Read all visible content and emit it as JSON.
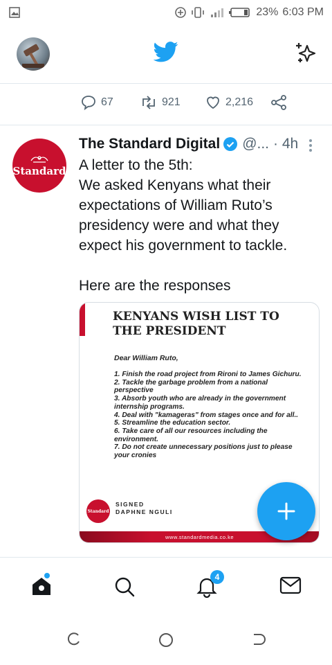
{
  "status_bar": {
    "battery_percent": "23%",
    "time": "6:03 PM"
  },
  "top_bar": {
    "logo_icon": "twitter-bird-icon",
    "sparkle_icon": "sparkle-icon"
  },
  "previous_tweet_actions": {
    "replies": "67",
    "retweets": "921",
    "likes": "2,216"
  },
  "tweet": {
    "author_name": "The Standard Digital",
    "verified": true,
    "handle": "@...",
    "time": "· 4h",
    "avatar_text": "Standard",
    "text_line1": "A letter to the 5th:",
    "text_line2": "We asked Kenyans what their expectations of William Ruto’s presidency were and what they expect his government to tackle.",
    "text_line3": "Here are the responses",
    "image": {
      "title": "KENYANS WISH LIST TO THE PRESIDENT",
      "salutation": "Dear William Ruto,",
      "items": [
        "1. Finish the road project from Rironi to James Gichuru.",
        "2. Tackle the garbage problem from a national perspective",
        "3. Absorb youth who are already in the government internship programs.",
        "4. Deal with \"kamageras\" from stages once and for all..",
        "5. Streamline the education sector.",
        "6. Take care of all our resources including the environment.",
        "7. Do not create unnecessary positions just to please your cronies"
      ],
      "signed_label": "SIGNED",
      "signed_name": "DAPHNE NGULI",
      "logo_text": "Standard",
      "footer_url": "www.standardmedia.co.ke"
    }
  },
  "bottom_nav": {
    "notifications_badge": "4",
    "brand_color": "#1da1f2"
  }
}
